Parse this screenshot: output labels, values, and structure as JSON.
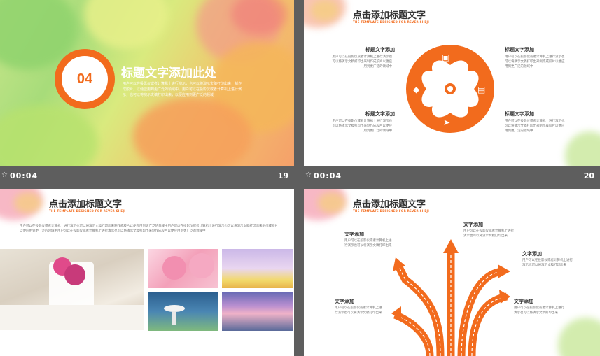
{
  "slides": [
    {
      "badge": "04",
      "title": "标题文字添加此处",
      "body": "用户可以在投影仪或者计算机上进行演示，也可以将演示文稿打印出来，制作成胶片，以便应用到更广泛的领域中。用户可以在投影仪或者计算机上进行演示，也可以将演示文稿打印出来，以便应用到更广泛的领域"
    },
    {
      "header": "点击添加标题文字",
      "subheader": "THE TEMPLATE DESIGNED FOR REVER SHEJI",
      "blocks": [
        {
          "title": "标题文字添加",
          "text": "用户可以在投影仪或者计算机上进行演示也可以将演示文稿打印出来制作成胶片以便应用到更广泛的领域中"
        },
        {
          "title": "标题文字添加",
          "text": "用户可以在投影仪或者计算机上进行演示也可以将演示文稿打印出来制作成胶片以便应用到更广泛的领域中"
        },
        {
          "title": "标题文字添加",
          "text": "用户可以在投影仪或者计算机上进行演示也可以将演示文稿打印出来制作成胶片以便应用到更广泛的领域中"
        },
        {
          "title": "标题文字添加",
          "text": "用户可以在投影仪或者计算机上进行演示也可以将演示文稿打印出来制作成胶片以便应用到更广泛的领域中"
        }
      ]
    },
    {
      "header": "点击添加标题文字",
      "subheader": "THE TEMPLATE DESIGNED FOR REVER SHEJI",
      "body": "用户可以在投影仪或者计算机上进行演示也可以将演示文稿打印出来制作成胶片以便应用到更广泛的领域中用户可以在投影仪或者计算机上进行演示也可以将演示文稿打印出来制作成胶片以便应用到更广泛的领域中用户可以在投影仪或者计算机上进行演示也可以将演示文稿打印出来制作成胶片以便应用到更广泛的领域中"
    },
    {
      "header": "点击添加标题文字",
      "subheader": "THE TEMPLATE DESIGNED FOR REVER SHEJI",
      "blocks": [
        {
          "title": "文字添加",
          "text": "用户可以在投影仪或者计算机上进行演示也可以将演示文稿打印出来"
        },
        {
          "title": "文字添加",
          "text": "用户可以在投影仪或者计算机上进行演示也可以将演示文稿打印出来"
        },
        {
          "title": "文字添加",
          "text": "用户可以在投影仪或者计算机上进行演示也可以将演示文稿打印出来"
        },
        {
          "title": "文字添加",
          "text": "用户可以在投影仪或者计算机上进行演示也可以将演示文稿打印出来"
        },
        {
          "title": "文字添加",
          "text": "用户可以在投影仪或者计算机上进行演示也可以将演示文稿打印出来"
        }
      ]
    }
  ],
  "thumbbars": [
    {
      "star": "☆",
      "time": "00:04",
      "number": "19"
    },
    {
      "star": "☆",
      "time": "00:04",
      "number": "20"
    }
  ],
  "colors": {
    "accent": "#f26b1d",
    "background": "#5e5e5e"
  },
  "icons": [
    "image-icon",
    "wallet-icon",
    "diamond-icon",
    "paper-plane-icon",
    "star-icon"
  ]
}
